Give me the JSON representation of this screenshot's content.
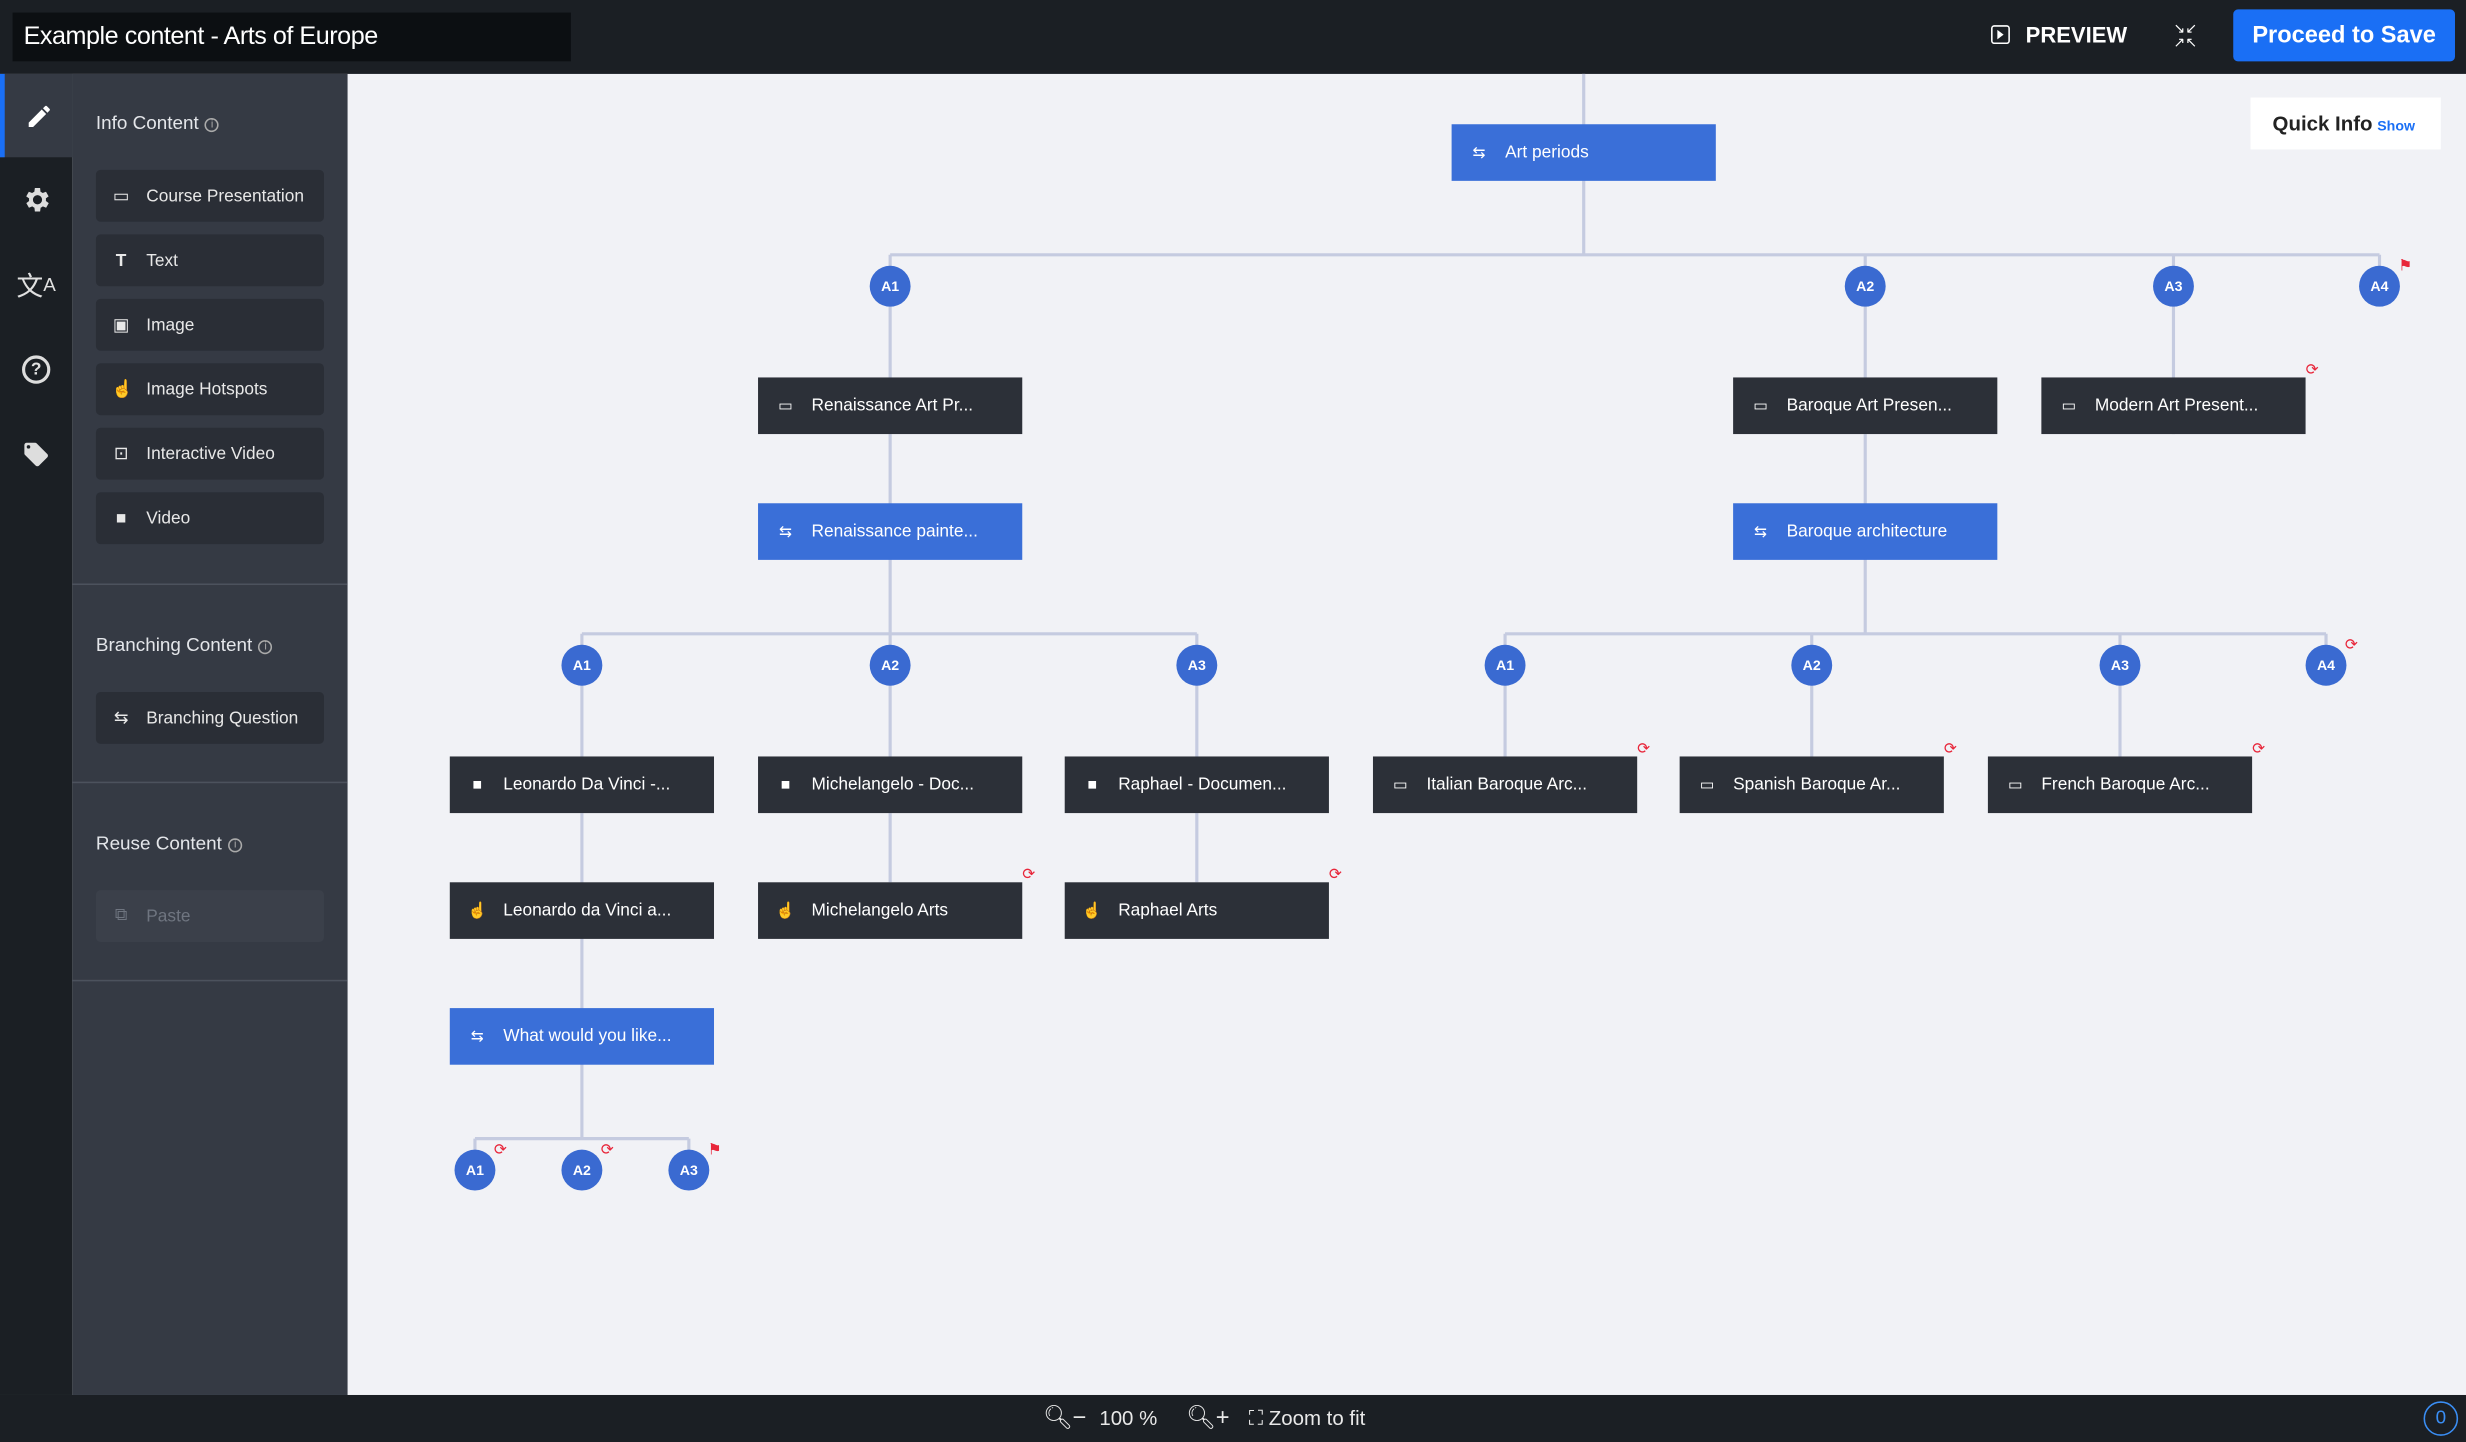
{
  "header": {
    "title": "Example content - Arts of Europe",
    "preview_label": "PREVIEW",
    "save_label": "Proceed to Save"
  },
  "colors": {
    "accent": "#1a6ff5",
    "branch_node": "#3a6fd8",
    "content_node": "#2c3038",
    "alternative_circle": "#3a6ad1",
    "warning": "#e8263a"
  },
  "rail": {
    "items": [
      {
        "icon": "pencil-icon",
        "active": true
      },
      {
        "icon": "gear-icon"
      },
      {
        "icon": "translate-icon"
      },
      {
        "icon": "help-icon"
      },
      {
        "icon": "tag-icon"
      }
    ]
  },
  "sidebar": {
    "info_content": {
      "label": "Info Content",
      "items": [
        {
          "label": "Course Presentation",
          "icon": "monitor-icon"
        },
        {
          "label": "Text",
          "icon": "text-icon"
        },
        {
          "label": "Image",
          "icon": "image-icon"
        },
        {
          "label": "Image Hotspots",
          "icon": "hotspot-icon"
        },
        {
          "label": "Interactive Video",
          "icon": "interactive-video-icon"
        },
        {
          "label": "Video",
          "icon": "video-camera-icon"
        }
      ]
    },
    "branching_content": {
      "label": "Branching Content",
      "items": [
        {
          "label": "Branching Question",
          "icon": "branch-icon"
        }
      ]
    },
    "reuse_content": {
      "label": "Reuse Content",
      "items": [
        {
          "label": "Paste",
          "icon": "paste-icon",
          "disabled": true
        }
      ]
    }
  },
  "quick_info": {
    "label": "Quick Info",
    "toggle": "Show"
  },
  "tree": {
    "nodes": [
      {
        "id": "n0",
        "label": "Art periods",
        "kind": "branch"
      },
      {
        "id": "n1",
        "label": "Renaissance Art Pr...",
        "kind": "presentation"
      },
      {
        "id": "n2",
        "label": "Baroque Art Presen...",
        "kind": "presentation"
      },
      {
        "id": "n3",
        "label": "Modern Art Present...",
        "kind": "presentation",
        "marker": "loop"
      },
      {
        "id": "n4",
        "label": "Renaissance painte...",
        "kind": "branch"
      },
      {
        "id": "n5",
        "label": "Baroque architecture",
        "kind": "branch"
      },
      {
        "id": "n6",
        "label": "Leonardo Da Vinci -...",
        "kind": "video"
      },
      {
        "id": "n7",
        "label": "Michelangelo - Doc...",
        "kind": "video"
      },
      {
        "id": "n8",
        "label": "Raphael - Documen...",
        "kind": "video"
      },
      {
        "id": "n9",
        "label": "Italian Baroque Arc...",
        "kind": "presentation",
        "marker": "loop"
      },
      {
        "id": "n10",
        "label": "Spanish Baroque Ar...",
        "kind": "presentation",
        "marker": "loop"
      },
      {
        "id": "n11",
        "label": "French Baroque Arc...",
        "kind": "presentation",
        "marker": "loop"
      },
      {
        "id": "n12",
        "label": "Leonardo da Vinci a...",
        "kind": "hotspots"
      },
      {
        "id": "n13",
        "label": "Michelangelo Arts",
        "kind": "hotspots",
        "marker": "loop"
      },
      {
        "id": "n14",
        "label": "Raphael Arts",
        "kind": "hotspots",
        "marker": "loop"
      },
      {
        "id": "n15",
        "label": "What would you like...",
        "kind": "branch"
      }
    ],
    "alternatives": [
      {
        "id": "c0",
        "label": "A1"
      },
      {
        "id": "c1",
        "label": "A2"
      },
      {
        "id": "c2",
        "label": "A3"
      },
      {
        "id": "c3",
        "label": "A4",
        "marker": "end"
      },
      {
        "id": "c4",
        "label": "A1"
      },
      {
        "id": "c5",
        "label": "A2"
      },
      {
        "id": "c6",
        "label": "A3"
      },
      {
        "id": "c7",
        "label": "A1"
      },
      {
        "id": "c8",
        "label": "A2"
      },
      {
        "id": "c9",
        "label": "A3"
      },
      {
        "id": "c10",
        "label": "A4",
        "marker": "loop"
      },
      {
        "id": "c11",
        "label": "A1",
        "marker": "loop"
      },
      {
        "id": "c12",
        "label": "A2",
        "marker": "loop"
      },
      {
        "id": "c13",
        "label": "A3",
        "marker": "end"
      }
    ]
  },
  "footer": {
    "zoom_level": "100 %",
    "zoom_fit_label": "Zoom to fit",
    "counter": "0"
  }
}
